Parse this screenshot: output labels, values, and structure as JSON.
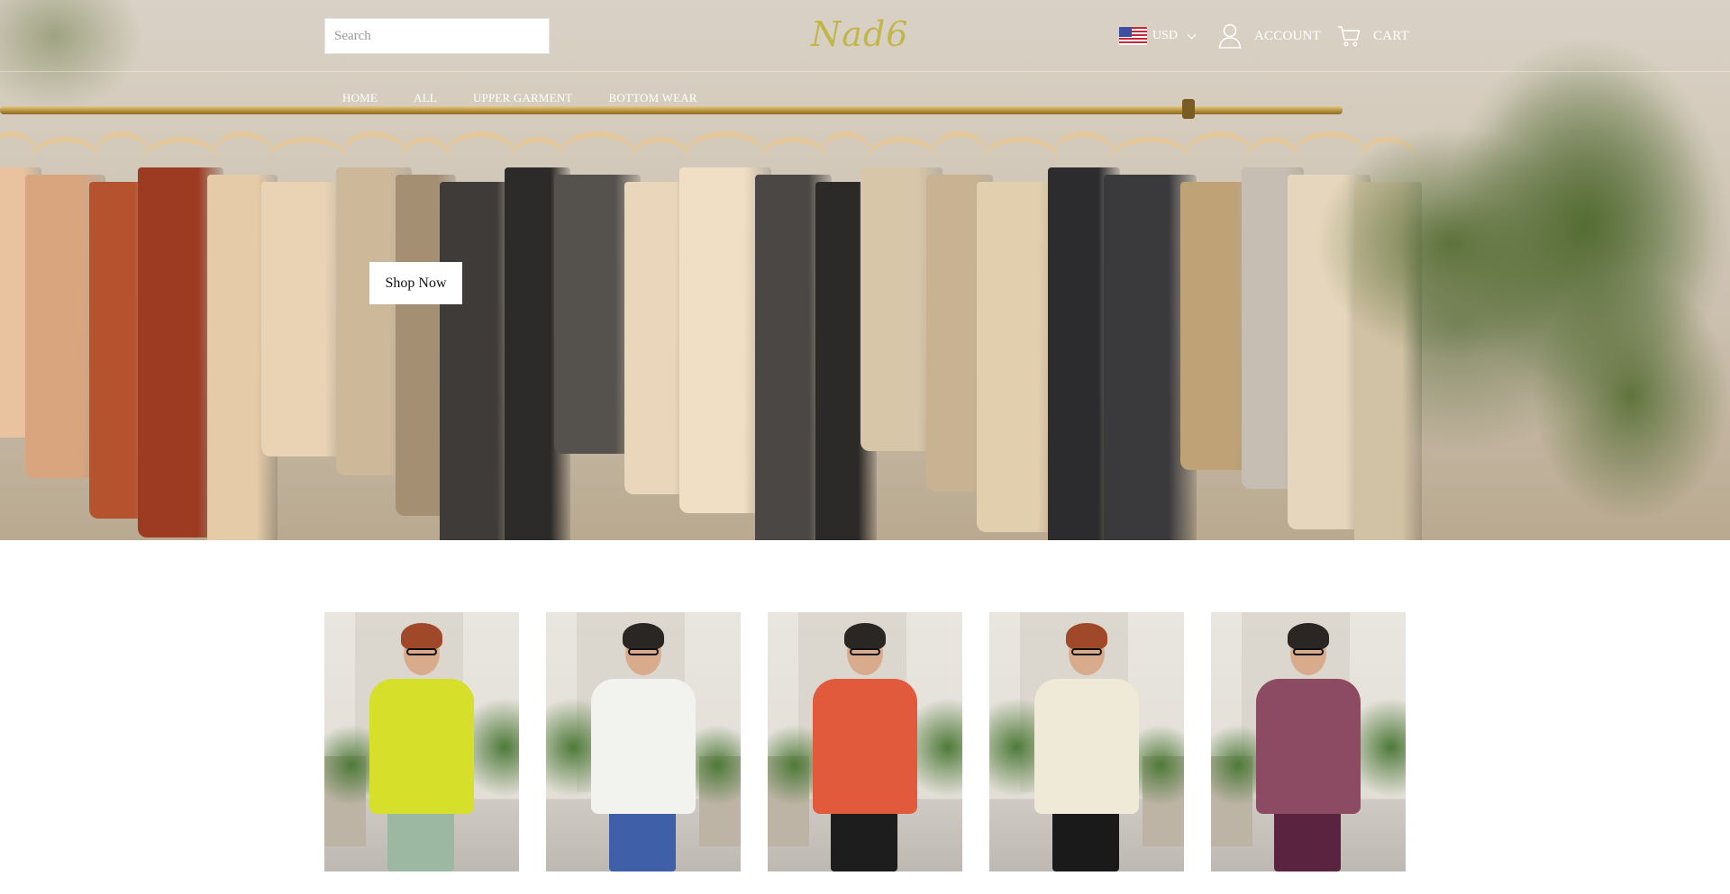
{
  "header": {
    "search_placeholder": "Search",
    "logo_text": "Nad6",
    "currency": "USD",
    "account_label": "ACCOUNT",
    "cart_label": "CART"
  },
  "menu": {
    "items": [
      {
        "label": "HOME"
      },
      {
        "label": "ALL"
      },
      {
        "label": "UPPER GARMENT"
      },
      {
        "label": "BOTTOM WEAR"
      }
    ]
  },
  "hero": {
    "cta_label": "Shop Now"
  },
  "colors": {
    "logo": "#c2b64a",
    "nav_text": "#ffffff",
    "button_bg": "#ffffff"
  },
  "icons": {
    "flag": "us-flag-icon",
    "account": "user-icon",
    "cart": "cart-icon",
    "currency_dropdown": "chevron-down-icon"
  },
  "products": [
    {
      "top_color": "#d6e02a",
      "pants_color": "#9db8a2"
    },
    {
      "top_color": "#f2f2ee",
      "pants_color": "#3f5fa8"
    },
    {
      "top_color": "#e25a3c",
      "pants_color": "#1d1d1d"
    },
    {
      "top_color": "#efe9d8",
      "pants_color": "#1a1a1a"
    },
    {
      "top_color": "#8c4a63",
      "pants_color": "#5a2440"
    }
  ]
}
